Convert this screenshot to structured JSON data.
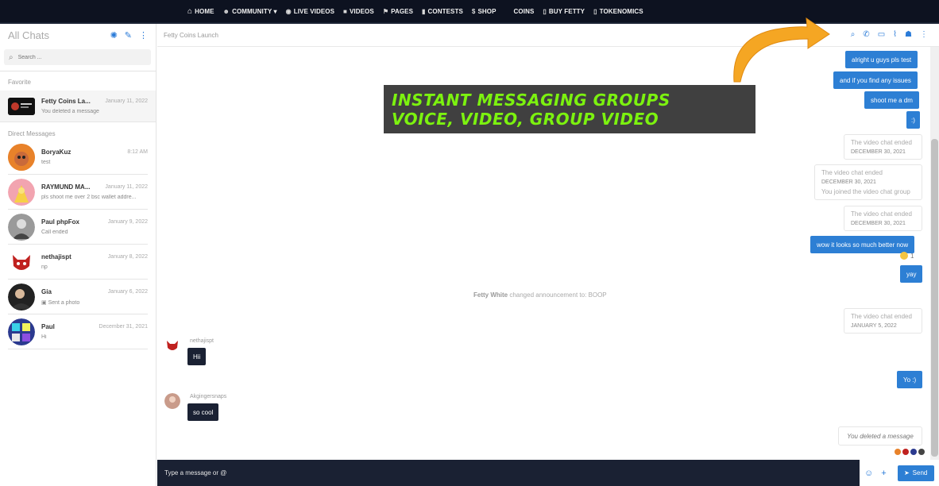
{
  "nav": {
    "home": "HOME",
    "community": "COMMUNITY ▾",
    "live_videos": "LIVE VIDEOS",
    "videos": "VIDEOS",
    "pages": "PAGES",
    "contests": "CONTESTS",
    "shop": "SHOP",
    "coins": "COINS",
    "buy_fetty": "BUY FETTY",
    "tokenomics": "TOKENOMICS"
  },
  "sidebar": {
    "title": "All Chats",
    "search_placeholder": "Search ...",
    "favorite_label": "Favorite",
    "direct_label": "Direct Messages",
    "favorites": [
      {
        "name": "Fetty Coins La...",
        "date": "January 11, 2022",
        "preview": "You deleted a message"
      }
    ],
    "direct": [
      {
        "name": "BoryaKuz",
        "date": "8:12 AM",
        "preview": "test"
      },
      {
        "name": "RAYMUND MA...",
        "date": "January 11, 2022",
        "preview": "pls shoot me over 2 bsc wallet addre..."
      },
      {
        "name": "Paul phpFox",
        "date": "January 9, 2022",
        "preview": "Call ended"
      },
      {
        "name": "nethajispt",
        "date": "January 8, 2022",
        "preview": "np"
      },
      {
        "name": "Gia",
        "date": "January 6, 2022",
        "preview": "Sent a photo"
      },
      {
        "name": "Paul",
        "date": "December 31, 2021",
        "preview": "Hi"
      }
    ]
  },
  "conversation": {
    "title": "Fetty Coins Launch"
  },
  "banner": {
    "line1": "INSTANT MESSAGING GROUPS",
    "line2": "VOICE, VIDEO, GROUP VIDEO"
  },
  "messages": {
    "out1": "alright u guys pls test",
    "out2": "and if you find any issues",
    "out3": "shoot me a dm",
    "out4": ":)",
    "vc1_title": "The video chat ended",
    "vc1_date": "DECEMBER 30, 2021",
    "vc2_title": "The video chat ended",
    "vc2_date": "DECEMBER 30, 2021",
    "vc2_note": "You joined the video chat group",
    "vc3_title": "The video chat ended",
    "vc3_date": "DECEMBER 30, 2021",
    "out5": "wow it looks so much better now",
    "reaction_count": "1",
    "out6": "yay",
    "notice_user": "Fetty White",
    "notice_text": " changed announcement to: BOOP",
    "vc4_title": "The video chat ended",
    "vc4_date": "JANUARY 5, 2022",
    "in1_sender": "nethajispt",
    "in1_text": "Hii",
    "out7": "Yo :)",
    "in2_sender": "Akgingersnaps",
    "in2_text": "so cool",
    "deleted": "You deleted a message"
  },
  "composer": {
    "placeholder": "Type a message or @",
    "send_label": "Send"
  },
  "colors": {
    "accent": "#2d7fd4",
    "nav_bg": "#0d1220",
    "banner_text": "#7cf20f",
    "arrow": "#f5a623"
  }
}
